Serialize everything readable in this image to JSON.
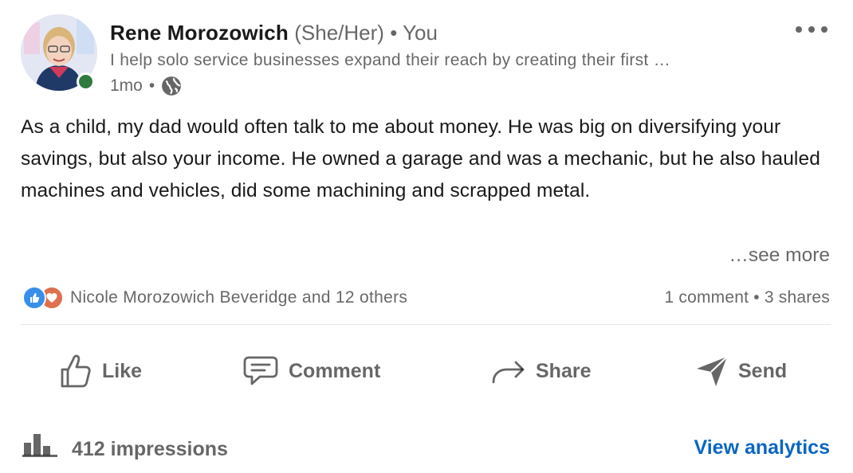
{
  "author": {
    "name": "Rene Morozowich",
    "pronouns": "(She/Her)",
    "separator": "•",
    "relation": "You",
    "headline": "I help solo service businesses expand their reach by creating their first …",
    "time_ago": "1mo",
    "time_separator": "•",
    "visibility_icon": "globe-icon",
    "presence_color": "#2f7a3d"
  },
  "post": {
    "text": "As a child, my dad would often talk to me about money. He was big on diversifying your savings, but also your income. He owned a garage and was a mechanic, but he also hauled machines and vehicles, did some machining and scrapped metal.",
    "see_more": "…see more"
  },
  "social": {
    "reaction_icons": [
      "like-reaction-icon",
      "love-reaction-icon"
    ],
    "reactors": "Nicole Morozowich Beveridge and 12 others",
    "comments": "1 comment",
    "dot": "•",
    "shares": "3 shares"
  },
  "actions": {
    "like": "Like",
    "comment": "Comment",
    "share": "Share",
    "send": "Send"
  },
  "footer": {
    "impressions": "412 impressions",
    "analytics_link": "View analytics",
    "link_color": "#0a66c2"
  }
}
